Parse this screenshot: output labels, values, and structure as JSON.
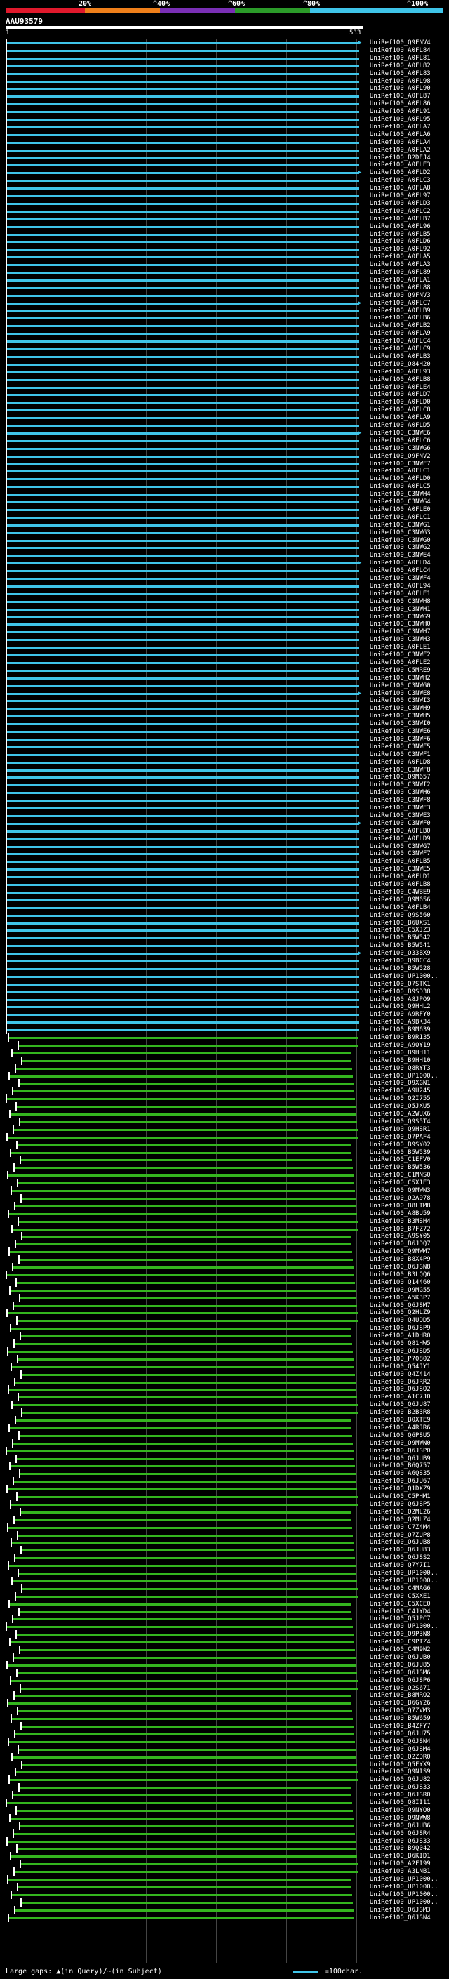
{
  "header": {
    "pct_labels": [
      "20%",
      "^40%",
      "^60%",
      "^80%",
      "^100%"
    ],
    "bar_colors": [
      "#e0192c",
      "#ef7f1a",
      "#7a2fb5",
      "#2b9b29",
      "#3fc4e8"
    ]
  },
  "query": {
    "label": "AAU93579",
    "start": "1",
    "end": "533"
  },
  "colors": {
    "high": "#3fc4e8",
    "mid": "#34b51e",
    "bg": "#000000"
  },
  "hits": [
    "UniRef100_Q9FNV4",
    "UniRef100_A0FL84",
    "UniRef100_A0FL81",
    "UniRef100_A0FL82",
    "UniRef100_A0FL83",
    "UniRef100_A0FL98",
    "UniRef100_A0FL90",
    "UniRef100_A0FL87",
    "UniRef100_A0FL86",
    "UniRef100_A0FL91",
    "UniRef100_A0FL95",
    "UniRef100_A0FLA7",
    "UniRef100_A0FLA6",
    "UniRef100_A0FLA4",
    "UniRef100_A0FLA2",
    "UniRef100_B2DEJ4",
    "UniRef100_A0FLE3",
    "UniRef100_A0FLD2",
    "UniRef100_A0FLC3",
    "UniRef100_A0FLA8",
    "UniRef100_A0FL97",
    "UniRef100_A0FLD3",
    "UniRef100_A0FLC2",
    "UniRef100_A0FLB7",
    "UniRef100_A0FL96",
    "UniRef100_A0FLB5",
    "UniRef100_A0FLD6",
    "UniRef100_A0FL92",
    "UniRef100_A0FLA5",
    "UniRef100_A0FLA3",
    "UniRef100_A0FL89",
    "UniRef100_A0FLA1",
    "UniRef100_A0FL88",
    "UniRef100_Q9FNV3",
    "UniRef100_A0FLC7",
    "UniRef100_A0FLB9",
    "UniRef100_A0FLB6",
    "UniRef100_A0FLB2",
    "UniRef100_A0FLA9",
    "UniRef100_A0FLC4",
    "UniRef100_A0FLC9",
    "UniRef100_A0FLB3",
    "UniRef100_Q84H20",
    "UniRef100_A0FL93",
    "UniRef100_A0FLB8",
    "UniRef100_A0FLE4",
    "UniRef100_A0FLD7",
    "UniRef100_A0FLD0",
    "UniRef100_A0FLC8",
    "UniRef100_A0FLA9",
    "UniRef100_A0FLD5",
    "UniRef100_C3NWE6",
    "UniRef100_A0FLC6",
    "UniRef100_C3NWG6",
    "UniRef100_Q9FNV2",
    "UniRef100_C3NWF7",
    "UniRef100_A0FLC1",
    "UniRef100_A0FLD0",
    "UniRef100_A0FLC5",
    "UniRef100_C3NWH4",
    "UniRef100_C3NWG4",
    "UniRef100_A0FLE0",
    "UniRef100_A0FLC1",
    "UniRef100_C3NWG1",
    "UniRef100_C3NWG3",
    "UniRef100_C3NWG0",
    "UniRef100_C3NWG2",
    "UniRef100_C3NWE4",
    "UniRef100_A0FLD4",
    "UniRef100_A0FLC4",
    "UniRef100_C3NWF4",
    "UniRef100_A0FL94",
    "UniRef100_A0FLE1",
    "UniRef100_C3NWH8",
    "UniRef100_C3NWH1",
    "UniRef100_C3NWG9",
    "UniRef100_C3NWH0",
    "UniRef100_C3NWH7",
    "UniRef100_C3NWH3",
    "UniRef100_A0FLE1",
    "UniRef100_C3NWF2",
    "UniRef100_A0FLE2",
    "UniRef100_C5MRE9",
    "UniRef100_C3NWH2",
    "UniRef100_C3NWG0",
    "UniRef100_C3NWE8",
    "UniRef100_C3NWI3",
    "UniRef100_C3NWH9",
    "UniRef100_C3NWH5",
    "UniRef100_C3NWI0",
    "UniRef100_C3NWE6",
    "UniRef100_C3NWF6",
    "UniRef100_C3NWF5",
    "UniRef100_C3NWF1",
    "UniRef100_A0FLD8",
    "UniRef100_C3NWF8",
    "UniRef100_Q9M657",
    "UniRef100_C3NWI2",
    "UniRef100_C3NWH6",
    "UniRef100_C3NWF8",
    "UniRef100_C3NWF3",
    "UniRef100_C3NWE3",
    "UniRef100_C3NWF0",
    "UniRef100_A0FLB0",
    "UniRef100_A0FLD9",
    "UniRef100_C3NWG7",
    "UniRef100_C3NWF7",
    "UniRef100_A0FLB5",
    "UniRef100_C3NWE5",
    "UniRef100_A0FLD1",
    "UniRef100_A0FLB8",
    "UniRef100_C4WBE9",
    "UniRef100_Q9M656",
    "UniRef100_A0FLB4",
    "UniRef100_Q9S560",
    "UniRef100_B6UXS1",
    "UniRef100_C5XJZ3",
    "UniRef100_B5W542",
    "UniRef100_B5W541",
    "UniRef100_Q33BX9",
    "UniRef100_Q9BCC4",
    "UniRef100_B5W528",
    "UniRef100_UP1000..",
    "UniRef100_Q7STK1",
    "UniRef100_B9SD38",
    "UniRef100_A8JPO9",
    "UniRef100_Q9HHL2",
    "UniRef100_A9RFY0",
    "UniRef100_A9BK34",
    "UniRef100_B9M639",
    "UniRef100_B9R135",
    "UniRef100_A9QY19",
    "UniRef100_B9HH11",
    "UniRef100_B9HH10",
    "UniRef100_Q8RYT3",
    "UniRef100_UP1000..",
    "UniRef100_Q9XGN1",
    "UniRef100_A9U245",
    "UniRef100_Q2I755",
    "UniRef100_Q5JXU5",
    "UniRef100_A2WUX6",
    "UniRef100_Q9S5T4",
    "UniRef100_Q9HSR1",
    "UniRef100_Q7PAF4",
    "UniRef100_B9SY02",
    "UniRef100_B5W539",
    "UniRef100_C1EFV0",
    "UniRef100_B5W536",
    "UniRef100_C1MNS0",
    "UniRef100_C5X1E3",
    "UniRef100_Q9MWN3",
    "UniRef100_Q2A978",
    "UniRef100_B8LTM8",
    "UniRef100_A8BU59",
    "UniRef100_B3MSH4",
    "UniRef100_B7FZ72",
    "UniRef100_A9SY05",
    "UniRef100_B6JDQ7",
    "UniRef100_Q9MWM7",
    "UniRef100_B8X4P9",
    "UniRef100_Q6JSN8",
    "UniRef100_B3LQQ6",
    "UniRef100_Q14460",
    "UniRef100_Q9MG55",
    "UniRef100_A5K3P7",
    "UniRef100_Q6JSM7",
    "UniRef100_Q2HLZ9",
    "UniRef100_Q4UDD5",
    "UniRef100_Q6JSP9",
    "UniRef100_A1DHR0",
    "UniRef100_Q81HW5",
    "UniRef100_Q6JSD5",
    "UniRef100_P70802",
    "UniRef100_Q54JY1",
    "UniRef100_Q4Z414",
    "UniRef100_Q6JRR2",
    "UniRef100_Q6JSQ2",
    "UniRef100_A1C7J0",
    "UniRef100_Q6JU87",
    "UniRef100_B2B3R8",
    "UniRef100_B0XTE9",
    "UniRef100_A4RJR6",
    "UniRef100_Q6PSU5",
    "UniRef100_Q9MWN0",
    "UniRef100_Q6JSP0",
    "UniRef100_Q6JUB9",
    "UniRef100_B6Q757",
    "UniRef100_A6QS35",
    "UniRef100_Q6JU67",
    "UniRef100_Q1DXZ9",
    "UniRef100_C5PHM1",
    "UniRef100_Q6JSP5",
    "UniRef100_Q2ML26",
    "UniRef100_Q2MLZ4",
    "UniRef100_C7Z4M4",
    "UniRef100_Q7ZUP8",
    "UniRef100_Q6JUB8",
    "UniRef100_Q6JU83",
    "UniRef100_Q6JSS2",
    "UniRef100_Q7Y7I1",
    "UniRef100_UP1000..",
    "UniRef100_UP1000..",
    "UniRef100_C4MAG6",
    "UniRef100_C5XXE1",
    "UniRef100_C5XCE0",
    "UniRef100_C4JYD4",
    "UniRef100_Q5JPC7",
    "UniRef100_UP1000..",
    "UniRef100_Q9P3N8",
    "UniRef100_C9PTZ4",
    "UniRef100_C4M9N2",
    "UniRef100_Q6JUB0",
    "UniRef100_Q6JU85",
    "UniRef100_Q6JSM6",
    "UniRef100_Q6JSP6",
    "UniRef100_Q2S671",
    "UniRef100_B8MRQ2",
    "UniRef100_B6GY26",
    "UniRef100_Q7ZVM3",
    "UniRef100_B5W659",
    "UniRef100_B4ZFY7",
    "UniRef100_Q6JU75",
    "UniRef100_Q6JSN4",
    "UniRef100_Q6JSM4",
    "UniRef100_Q2ZDR0",
    "UniRef100_Q5FYX9",
    "UniRef100_Q9NIS9",
    "UniRef100_Q6JU82",
    "UniRef100_Q6JS33",
    "UniRef100_Q6JSR0",
    "UniRef100_Q8II11",
    "UniRef100_Q9NYO0",
    "UniRef100_Q9NWW8",
    "UniRef100_Q6JUB6",
    "UniRef100_Q6JSR4",
    "UniRef100_Q6JS33",
    "UniRef100_B9Q042",
    "UniRef100_B6KID1",
    "UniRef100_A2FI99",
    "UniRef100_A3LNB1",
    "UniRef100_UP1000..",
    "UniRef100_UP1000..",
    "UniRef100_UP1000..",
    "UniRef100_UP1000..",
    "UniRef100_Q6JSM3",
    "UniRef100_Q6JSN4"
  ],
  "footer": {
    "text": "Large gaps: ▲(in Query)/~(in Subject)",
    "legend": "=100char."
  }
}
